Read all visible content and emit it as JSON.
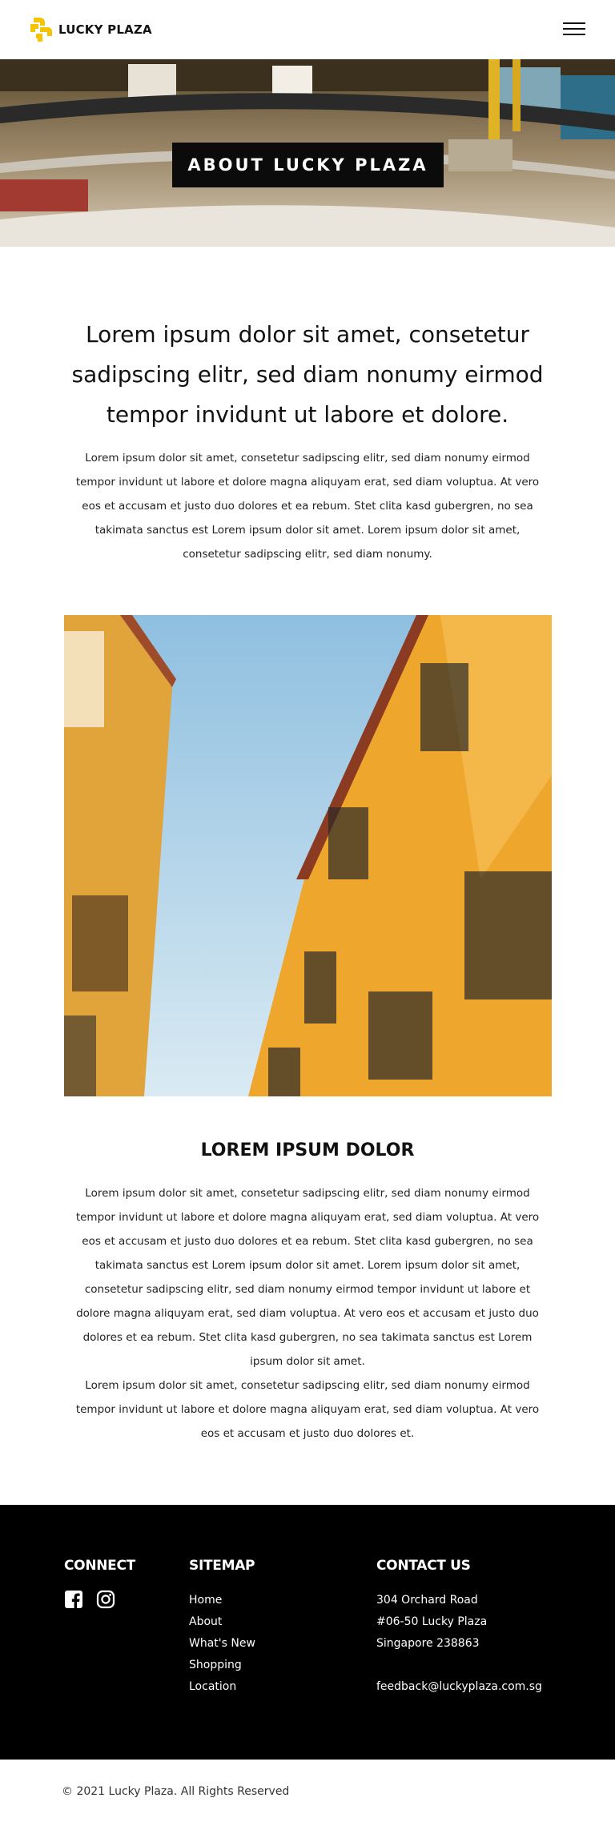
{
  "brand": {
    "name": "LUCKY PLAZA",
    "accent_color": "#f5c400"
  },
  "header": {
    "menu_icon": "hamburger-menu-icon"
  },
  "hero": {
    "title": "ABOUT LUCKY PLAZA"
  },
  "intro": {
    "lead": "Lorem ipsum dolor sit amet, consetetur sadipscing elitr, sed diam nonumy eirmod tempor invidunt ut labore et dolore.",
    "body": "Lorem ipsum dolor sit amet, consetetur sadipscing elitr, sed diam nonumy eirmod tempor invidunt ut labore et dolore magna aliquyam erat, sed diam voluptua. At vero eos et accusam et justo duo dolores et ea rebum. Stet clita kasd gubergren, no sea takimata sanctus est Lorem ipsum dolor sit amet. Lorem ipsum dolor sit amet, consetetur sadipscing elitr, sed diam nonumy."
  },
  "section2": {
    "title": "LOREM IPSUM DOLOR",
    "paragraph1": "Lorem ipsum dolor sit amet, consetetur sadipscing elitr, sed diam nonumy eirmod tempor invidunt ut labore et dolore magna aliquyam erat, sed diam voluptua. At vero eos et accusam et justo duo dolores et ea rebum. Stet clita kasd gubergren, no sea takimata sanctus est Lorem ipsum dolor sit amet. Lorem ipsum dolor sit amet, consetetur sadipscing elitr, sed diam nonumy eirmod tempor invidunt ut labore et dolore magna aliquyam erat, sed diam voluptua. At vero eos et accusam et justo duo dolores et ea rebum. Stet clita kasd gubergren, no sea takimata sanctus est Lorem ipsum dolor sit amet.",
    "paragraph2": "Lorem ipsum dolor sit amet, consetetur sadipscing elitr, sed diam nonumy eirmod tempor invidunt ut labore et dolore magna aliquyam erat, sed diam voluptua. At vero eos et accusam et justo duo dolores et."
  },
  "footer": {
    "connect": {
      "heading": "CONNECT",
      "icons": [
        "facebook-icon",
        "instagram-icon"
      ]
    },
    "sitemap": {
      "heading": "SITEMAP",
      "links": [
        "Home",
        "About",
        "What's New",
        "Shopping",
        "Location"
      ]
    },
    "contact": {
      "heading": "CONTACT US",
      "address_line1": "304 Orchard Road",
      "address_line2": "#06-50 Lucky Plaza",
      "address_line3": "Singapore 238863",
      "email": "feedback@luckyplaza.com.sg"
    }
  },
  "copyright": "© 2021 Lucky Plaza. All Rights Reserved"
}
